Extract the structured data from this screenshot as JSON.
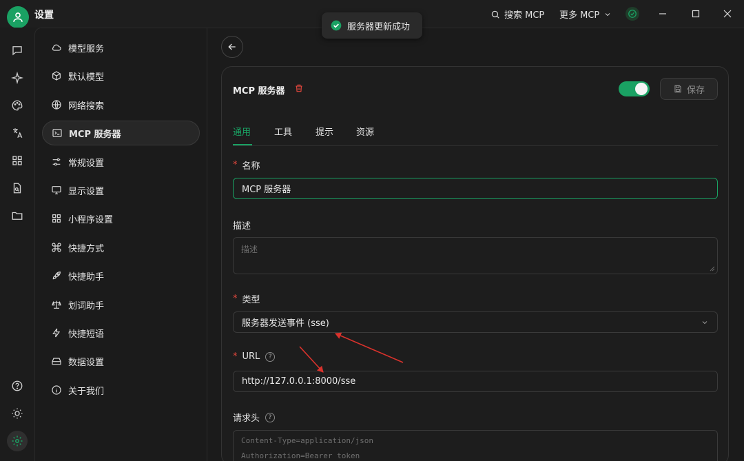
{
  "app": {
    "title": "设置"
  },
  "titlebar": {
    "search_label": "搜索 MCP",
    "more_label": "更多 MCP"
  },
  "toast": {
    "message": "服务器更新成功"
  },
  "sidebar": {
    "items": [
      {
        "label": "模型服务",
        "icon": "cloud-icon"
      },
      {
        "label": "默认模型",
        "icon": "cube-icon"
      },
      {
        "label": "网络搜索",
        "icon": "globe-icon"
      },
      {
        "label": "MCP 服务器",
        "icon": "terminal-icon"
      },
      {
        "label": "常规设置",
        "icon": "sliders-icon"
      },
      {
        "label": "显示设置",
        "icon": "monitor-icon"
      },
      {
        "label": "小程序设置",
        "icon": "grid-icon"
      },
      {
        "label": "快捷方式",
        "icon": "command-icon"
      },
      {
        "label": "快捷助手",
        "icon": "rocket-icon"
      },
      {
        "label": "划词助手",
        "icon": "scale-icon"
      },
      {
        "label": "快捷短语",
        "icon": "zap-icon"
      },
      {
        "label": "数据设置",
        "icon": "hard-drive-icon"
      },
      {
        "label": "关于我们",
        "icon": "info-icon"
      }
    ]
  },
  "server": {
    "title": "MCP 服务器",
    "enabled": true,
    "save_label": "保存",
    "tabs": [
      "通用",
      "工具",
      "提示",
      "资源"
    ],
    "fields": {
      "name_label": "名称",
      "name_value": "MCP 服务器",
      "desc_label": "描述",
      "desc_placeholder": "描述",
      "type_label": "类型",
      "type_value": "服务器发送事件 (sse)",
      "url_label": "URL",
      "url_value": "http://127.0.0.1:8000/sse",
      "headers_label": "请求头",
      "headers_placeholder_1": "Content-Type=application/json",
      "headers_placeholder_2": "Authorization=Bearer token"
    }
  },
  "colors": {
    "accent": "#1aa163",
    "required": "#e0463c",
    "arrow": "#d9322c"
  }
}
